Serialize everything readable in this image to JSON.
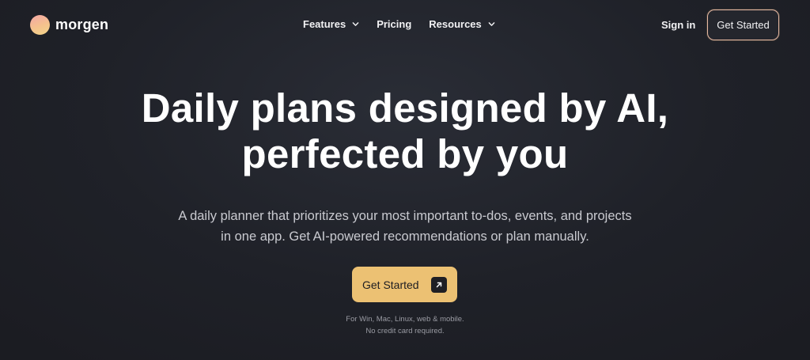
{
  "brand": {
    "name": "morgen",
    "logo_icon": "gradient-circle-logo"
  },
  "nav": {
    "items": [
      {
        "label": "Features",
        "has_dropdown": true
      },
      {
        "label": "Pricing",
        "has_dropdown": false
      },
      {
        "label": "Resources",
        "has_dropdown": true
      }
    ],
    "sign_in": "Sign in",
    "cta": "Get Started"
  },
  "hero": {
    "title_line1": "Daily plans designed by AI,",
    "title_line2": "perfected by you",
    "subtitle_line1": "A daily planner that prioritizes your most important to-dos, events, and projects",
    "subtitle_line2": "in one app. Get AI-powered recommendations or plan manually.",
    "cta": "Get Started",
    "cta_icon": "arrow-up-right-icon",
    "note_line1": "For Win, Mac, Linux, web & mobile.",
    "note_line2": "No credit card required."
  },
  "colors": {
    "background": "#1f2128",
    "accent": "#ecc173",
    "button_border": "#e7b9a3"
  }
}
